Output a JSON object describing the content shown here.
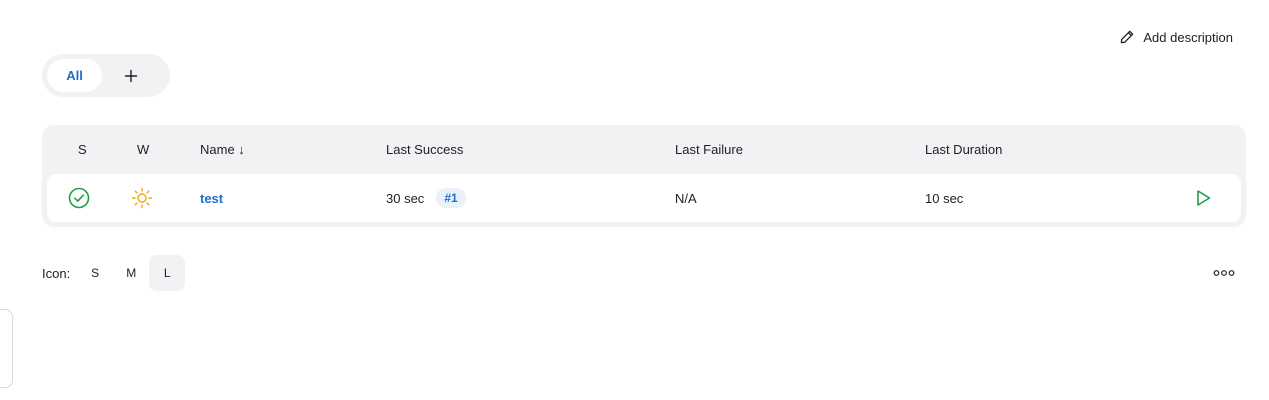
{
  "actions": {
    "add_description": "Add description"
  },
  "tabs": {
    "all_label": "All"
  },
  "table": {
    "headers": {
      "status": "S",
      "weather": "W",
      "name": "Name ↓",
      "last_success": "Last Success",
      "last_failure": "Last Failure",
      "last_duration": "Last Duration"
    },
    "rows": [
      {
        "status_icon": "success-check-icon",
        "weather_icon": "sunny-weather-icon",
        "name": "test",
        "last_success": "30 sec",
        "build": "#1",
        "last_failure": "N/A",
        "last_duration": "10 sec",
        "action_icon": "run-build-icon"
      }
    ]
  },
  "icon_size": {
    "label": "Icon:",
    "options": [
      "S",
      "M",
      "L"
    ],
    "selected": "L"
  },
  "colors": {
    "accent": "#1f6fd1",
    "success": "#1e9e4a",
    "sunny": "#f2a51a",
    "surface": "#f2f2f5"
  }
}
